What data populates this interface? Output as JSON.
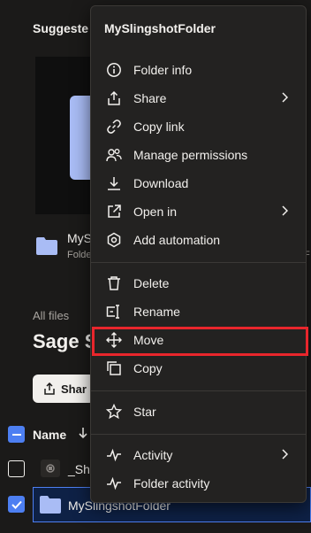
{
  "background": {
    "suggested_title": "Suggeste",
    "card": {
      "name": "MyS",
      "sub": "Folde",
      "sub_right": "F"
    },
    "all_files_label": "All files",
    "page_heading": "Sage S",
    "share_button": "Shar",
    "table": {
      "name_header": "Name",
      "sort_icon": "arrow-down-icon",
      "rows": [
        {
          "name": "_Sha",
          "selected": false,
          "icon": "slingshot-app-icon"
        },
        {
          "name": "MySlingshotFolder",
          "selected": true,
          "icon": "folder-icon"
        }
      ]
    }
  },
  "context_menu": {
    "title": "MySlingshotFolder",
    "groups": [
      [
        {
          "label": "Folder info",
          "icon": "info-icon",
          "submenu": false
        },
        {
          "label": "Share",
          "icon": "share-icon",
          "submenu": true
        },
        {
          "label": "Copy link",
          "icon": "link-icon",
          "submenu": false
        },
        {
          "label": "Manage permissions",
          "icon": "people-icon",
          "submenu": false
        },
        {
          "label": "Download",
          "icon": "download-icon",
          "submenu": false
        },
        {
          "label": "Open in",
          "icon": "open-in-icon",
          "submenu": true
        },
        {
          "label": "Add automation",
          "icon": "automation-icon",
          "submenu": false
        }
      ],
      [
        {
          "label": "Delete",
          "icon": "trash-icon",
          "submenu": false
        },
        {
          "label": "Rename",
          "icon": "rename-icon",
          "submenu": false
        },
        {
          "label": "Move",
          "icon": "move-icon",
          "submenu": false,
          "highlighted": true
        },
        {
          "label": "Copy",
          "icon": "copy-icon",
          "submenu": false
        }
      ],
      [
        {
          "label": "Star",
          "icon": "star-icon",
          "submenu": false
        }
      ],
      [
        {
          "label": "Activity",
          "icon": "activity-icon",
          "submenu": true
        },
        {
          "label": "Folder activity",
          "icon": "folder-activity-icon",
          "submenu": false
        }
      ]
    ]
  },
  "colors": {
    "menu_bg": "#232221",
    "highlight_border": "#e8262c",
    "accent": "#4d7ff2",
    "folder_blue": "#a9bcf5"
  }
}
